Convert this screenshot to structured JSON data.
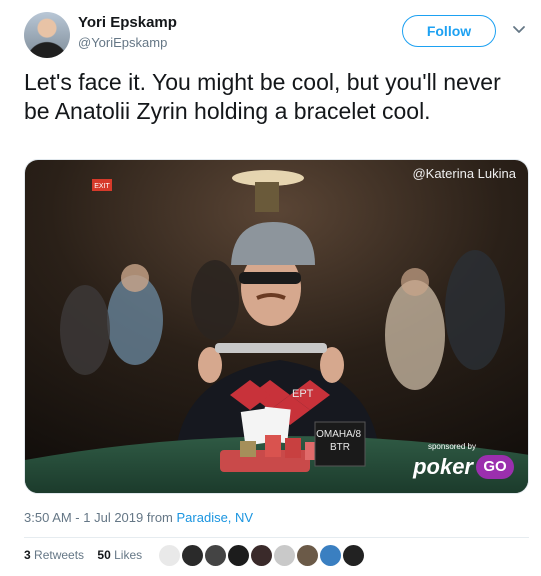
{
  "author": {
    "name": "Yori Epskamp",
    "handle": "@YoriEpskamp"
  },
  "follow_label": "Follow",
  "tweet": {
    "text": "Let's face it. You might be cool, but you'll never be Anatolii Zyrin holding a bracelet cool."
  },
  "media": {
    "credit": "@Katerina Lukina",
    "exit_sign": "EXIT",
    "shirt_logo": "EPT",
    "table_sign": "OMAHA/8\nBTR",
    "sponsored": "sponsored by",
    "brand": "poker",
    "brand_go": "GO"
  },
  "meta": {
    "time": "3:50 AM - 1 Jul 2019",
    "from": "from",
    "location": "Paradise, NV"
  },
  "stats": {
    "retweets_count": "3",
    "retweets_label": "Retweets",
    "likes_count": "50",
    "likes_label": "Likes"
  },
  "liker_colors": [
    "#e9e9e9",
    "#2a2a2a",
    "#444444",
    "#1c1c1c",
    "#3a2a2a",
    "#c9c9c9",
    "#6b5a48",
    "#3a7fc1",
    "#222222"
  ],
  "colors": {
    "accent": "#1da1f2",
    "secondary_text": "#657786",
    "brand_purple": "#9b2fae"
  }
}
